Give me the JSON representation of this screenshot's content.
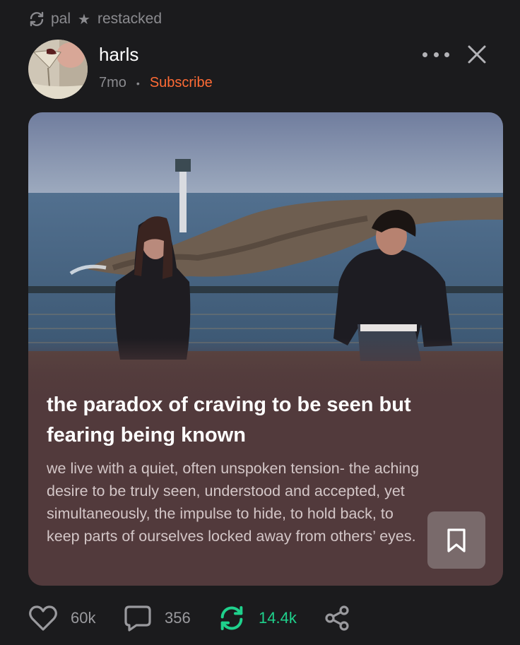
{
  "restack": {
    "icon": "restack-icon",
    "user": "pal",
    "separator_icon": "star-icon",
    "label": "restacked"
  },
  "post": {
    "author": "harls",
    "time": "7mo",
    "dot": "•",
    "subscribe_label": "Subscribe",
    "more_icon": "more-options-icon",
    "close_icon": "close-icon"
  },
  "card": {
    "title": "the paradox of craving to be seen but fearing being known",
    "excerpt": "we live with a quiet, often unspoken tension- the aching desire to be truly seen, understood and accepted, yet simultaneously, the impulse to hide, to hold back, to keep parts of ourselves locked away from others’ eyes.",
    "bookmark_icon": "bookmark-icon"
  },
  "actions": {
    "likes": "60k",
    "comments": "356",
    "restacks": "14.4k",
    "share_icon": "share-icon"
  },
  "colors": {
    "background": "#1b1b1d",
    "card": "#523a3c",
    "subscribe": "#ff6b35",
    "restack_active": "#1fd18c",
    "muted": "#8b8b8f"
  }
}
